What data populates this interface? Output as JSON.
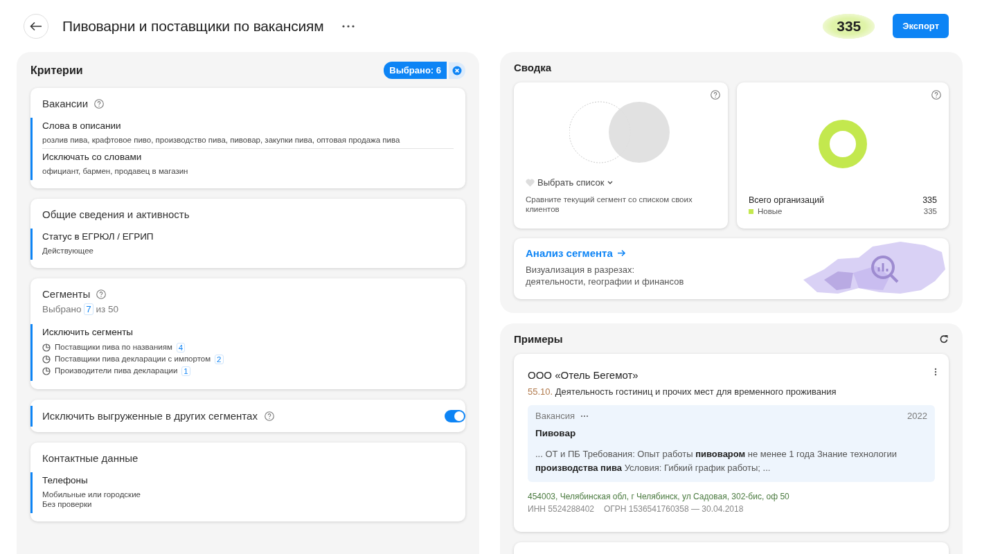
{
  "header": {
    "title": "Пивоварни и поставщики по вакансиям",
    "count": "335",
    "export_button": "Экспорт"
  },
  "criteria": {
    "title": "Критерии",
    "selected_badge": "Выбрано: 6",
    "sections": [
      {
        "kind": "group",
        "title": "Вакансии",
        "help": true,
        "items": [
          {
            "label": "Слова в описании",
            "lines": [
              "розлив пива, крафтовое пиво, производство пива, пивовар, закупки пива, оптовая продажа пива"
            ]
          },
          {
            "label": "Исключать со словами",
            "lines": [
              "официант, бармен, продавец в магазин"
            ]
          }
        ]
      },
      {
        "kind": "group",
        "title": "Общие сведения и активность",
        "help": false,
        "items": [
          {
            "label": "Статус в ЕГРЮЛ / ЕГРИП",
            "lines": [
              "Действующее"
            ]
          }
        ]
      },
      {
        "kind": "segments",
        "title": "Сегменты",
        "help": true,
        "selected_prefix": "Выбрано",
        "selected_count": "7",
        "selected_suffix": "из 50",
        "items": [
          {
            "label": "Исключить сегменты",
            "segments": [
              {
                "name": "Поставщики пива по названиям",
                "count": "4"
              },
              {
                "name": "Поставщики пива декларации с импортом",
                "count": "2"
              },
              {
                "name": "Производители пива декларации",
                "count": "1"
              }
            ]
          }
        ]
      },
      {
        "kind": "toggle",
        "title": "Исключить выгруженные в других сегментах",
        "help": true,
        "on": true
      },
      {
        "kind": "group",
        "title": "Контактные данные",
        "help": false,
        "items": [
          {
            "label": "Телефоны",
            "lines": [
              "Мобильные или городские",
              "Без проверки"
            ]
          }
        ]
      }
    ]
  },
  "summary": {
    "title": "Сводка",
    "compare": {
      "select_label": "Выбрать список",
      "hint": "Сравните текущий сегмент со списком своих клиентов"
    },
    "totals": {
      "label": "Всего организаций",
      "value": "335",
      "legend": [
        {
          "label": "Новые",
          "value": "335",
          "color": "#c3e84e"
        }
      ]
    },
    "analysis": {
      "link": "Анализ сегмента",
      "description_lines": [
        "Визуализация в разрезах:",
        "деятельности, географии и финансов"
      ]
    }
  },
  "examples": {
    "title": "Примеры",
    "cards": [
      {
        "company": "ООО «Отель Бегемот»",
        "okved_code": "55.10.",
        "okved_name": "Деятельность гостиниц и прочих мест для временного проживания",
        "vacancy": {
          "label": "Вакансия",
          "year": "2022",
          "title": "Пивовар",
          "snippet": "... ОТ и ПБ Требования: Опыт работы **пивоваром** не менее 1 года Знание технологии **производства пива** Условия: Гибкий график работы; ..."
        },
        "address": "454003, Челябинская обл, г Челябинск, ул Садовая, 302-бис, оф 50",
        "inn": "ИНН 5524288402",
        "ogrn": "ОГРН 1536541760358 — 30.04.2018"
      }
    ]
  }
}
